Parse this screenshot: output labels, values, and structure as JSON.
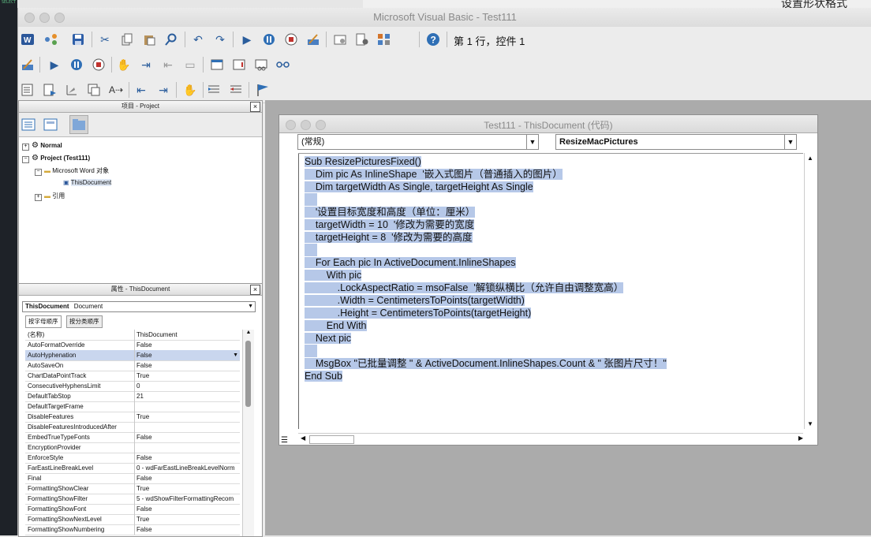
{
  "window": {
    "title": "Microsoft Visual Basic - Test111"
  },
  "background": {
    "right_panel_title": "设置形状格式",
    "left_code_hint": "SELECT"
  },
  "toolbar": {
    "status_position": "第 1 行，控件 1"
  },
  "project_panel": {
    "title": "项目 - Project",
    "tree": [
      {
        "label": "Normal",
        "bold": true
      },
      {
        "label": "Project (Test111)",
        "bold": true
      },
      {
        "label": "Microsoft Word 对象",
        "bold": false
      },
      {
        "label": "ThisDocument",
        "bold": false
      },
      {
        "label": "引用",
        "bold": false
      }
    ]
  },
  "properties_panel": {
    "title": "属性 - ThisDocument",
    "object_name": "ThisDocument",
    "object_type": "Document",
    "tab_alpha": "按字母顺序",
    "tab_category": "按分类顺序",
    "rows": [
      [
        "(名称)",
        "ThisDocument"
      ],
      [
        "AutoFormatOverride",
        "False"
      ],
      [
        "AutoHyphenation",
        "False"
      ],
      [
        "AutoSaveOn",
        "False"
      ],
      [
        "ChartDataPointTrack",
        "True"
      ],
      [
        "ConsecutiveHyphensLimit",
        "0"
      ],
      [
        "DefaultTabStop",
        "21"
      ],
      [
        "DefaultTargetFrame",
        ""
      ],
      [
        "DisableFeatures",
        "True"
      ],
      [
        "DisableFeaturesIntroducedAfter",
        ""
      ],
      [
        "EmbedTrueTypeFonts",
        "False"
      ],
      [
        "EncryptionProvider",
        ""
      ],
      [
        "EnforceStyle",
        "False"
      ],
      [
        "FarEastLineBreakLevel",
        "0 - wdFarEastLineBreakLevelNorm"
      ],
      [
        "Final",
        "False"
      ],
      [
        "FormattingShowClear",
        "True"
      ],
      [
        "FormattingShowFilter",
        "5 - wdShowFilterFormattingRecom"
      ],
      [
        "FormattingShowFont",
        "False"
      ],
      [
        "FormattingShowNextLevel",
        "True"
      ],
      [
        "FormattingShowNumbering",
        "False"
      ]
    ]
  },
  "code_window": {
    "title": "Test111 - ThisDocument (代码)",
    "object_combo": "(常规)",
    "proc_combo": "ResizeMacPictures",
    "lines": [
      "Sub ResizePicturesFixed()",
      "    Dim pic As InlineShape  '嵌入式图片（普通插入的图片）",
      "    Dim targetWidth As Single, targetHeight As Single",
      "",
      "    '设置目标宽度和高度（单位：厘米）",
      "    targetWidth = 10  '修改为需要的宽度",
      "    targetHeight = 8  '修改为需要的高度",
      "",
      "    For Each pic In ActiveDocument.InlineShapes",
      "        With pic",
      "            .LockAspectRatio = msoFalse  '解锁纵横比（允许自由调整宽高）",
      "            .Width = CentimetersToPoints(targetWidth)",
      "            .Height = CentimetersToPoints(targetHeight)",
      "        End With",
      "    Next pic",
      "",
      "    MsgBox \"已批量调整 \" & ActiveDocument.InlineShapes.Count & \" 张图片尺寸！\"",
      "End Sub"
    ]
  },
  "icons": {
    "toolbar1": [
      "word-icon",
      "branch-icon",
      "save-icon",
      "cut-icon",
      "copy-icon",
      "paste-icon",
      "find-icon",
      "undo-icon",
      "redo-icon",
      "run-icon",
      "pause-icon",
      "stop-icon",
      "design-mode-icon",
      "project-explorer-icon",
      "properties-icon",
      "toolbox-icon",
      "help-icon"
    ],
    "toolbar2": [
      "design-mode-icon",
      "run-icon",
      "pause-icon",
      "stop-icon",
      "hand-icon",
      "step-into-icon",
      "step-over-icon",
      "step-out-icon",
      "locals-icon",
      "immediate-icon",
      "watch-icon",
      "quick-watch-icon"
    ],
    "toolbar3": [
      "list-members-icon",
      "list-constants-icon",
      "quick-info-icon",
      "parameter-info-icon",
      "complete-word-icon",
      "outdent-icon",
      "indent-icon",
      "hand-icon",
      "comment-block-icon",
      "uncomment-block-icon",
      "bookmark-flag-icon"
    ]
  }
}
